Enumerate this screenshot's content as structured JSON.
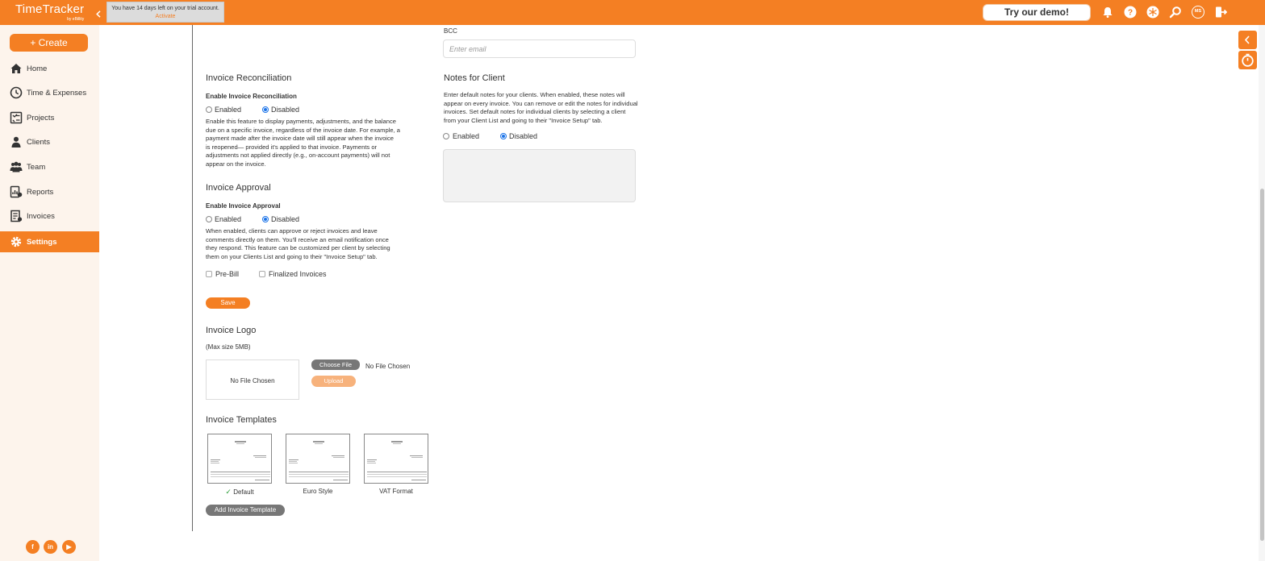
{
  "header": {
    "logo_text": "TimeTracker",
    "logo_sub": "by eBillity",
    "trial_message": "You have 14 days left on your trial account.",
    "trial_action": "Activate",
    "demo_button": "Try our demo!",
    "avatar_initials": "MS",
    "icons": [
      "bell-icon",
      "help-icon",
      "network-icon",
      "search-icon",
      "avatar",
      "logout-icon"
    ]
  },
  "sidebar": {
    "create_label": "+ Create",
    "items": [
      {
        "label": "Home",
        "icon": "home-icon"
      },
      {
        "label": "Time & Expenses",
        "icon": "clock-icon"
      },
      {
        "label": "Projects",
        "icon": "projects-icon"
      },
      {
        "label": "Clients",
        "icon": "clients-icon"
      },
      {
        "label": "Team",
        "icon": "team-icon"
      },
      {
        "label": "Reports",
        "icon": "reports-icon"
      },
      {
        "label": "Invoices",
        "icon": "invoices-icon"
      },
      {
        "label": "Settings",
        "icon": "gear-icon",
        "active": true
      }
    ],
    "social": [
      "f",
      "in",
      "▶"
    ]
  },
  "bcc": {
    "label": "BCC",
    "placeholder": "Enter email"
  },
  "reconciliation": {
    "title": "Invoice Reconciliation",
    "sub_label": "Enable Invoice Reconciliation",
    "enabled_label": "Enabled",
    "disabled_label": "Disabled",
    "selected": "Disabled",
    "lines": [
      "Enable this feature to display payments, adjustments, and the balance",
      "due on a specific invoice, regardless of the invoice date. For example, a",
      "payment made after the invoice date will still appear when the invoice",
      "is reopened— provided it's applied to that invoice. Payments or",
      "adjustments not applied directly (e.g., on-account payments) will not",
      "appear on the invoice."
    ]
  },
  "notes": {
    "title": "Notes for Client",
    "lines": [
      "Enter default notes for your clients. When enabled, these notes will",
      "appear on every invoice. You can remove or edit the notes for individual",
      "invoices. Set default notes for individual clients by selecting a client",
      "from your Client List and going to their \"Invoice Setup\" tab."
    ],
    "enabled_label": "Enabled",
    "disabled_label": "Disabled",
    "selected": "Disabled",
    "text_value": ""
  },
  "approval": {
    "title": "Invoice Approval",
    "sub_label": "Enable Invoice Approval",
    "enabled_label": "Enabled",
    "disabled_label": "Disabled",
    "selected": "Disabled",
    "lines": [
      "When enabled, clients can approve or reject invoices and leave",
      "comments directly on them. You'll receive an email notification once",
      "they respond. This feature can be customized per client by selecting",
      "them on your Clients List and going to their \"Invoice Setup\" tab."
    ],
    "prebill_label": "Pre-Bill",
    "finalized_label": "Finalized Invoices"
  },
  "save_label": "Save",
  "logo_section": {
    "title": "Invoice Logo",
    "max_size": "(Max size 5MB)",
    "preview_text": "No File Chosen",
    "choose_label": "Choose File",
    "file_status": "No File Chosen",
    "upload_label": "Upload"
  },
  "templates": {
    "title": "Invoice Templates",
    "items": [
      {
        "name": "Default",
        "selected": true
      },
      {
        "name": "Euro Style",
        "selected": false
      },
      {
        "name": "VAT Format",
        "selected": false
      }
    ],
    "check_mark": "✓",
    "add_label": "Add Invoice Template"
  },
  "colors": {
    "brand": "#f47f23",
    "sidebar_bg": "#fdf4ec",
    "radio_selected": "#1a73e8"
  }
}
